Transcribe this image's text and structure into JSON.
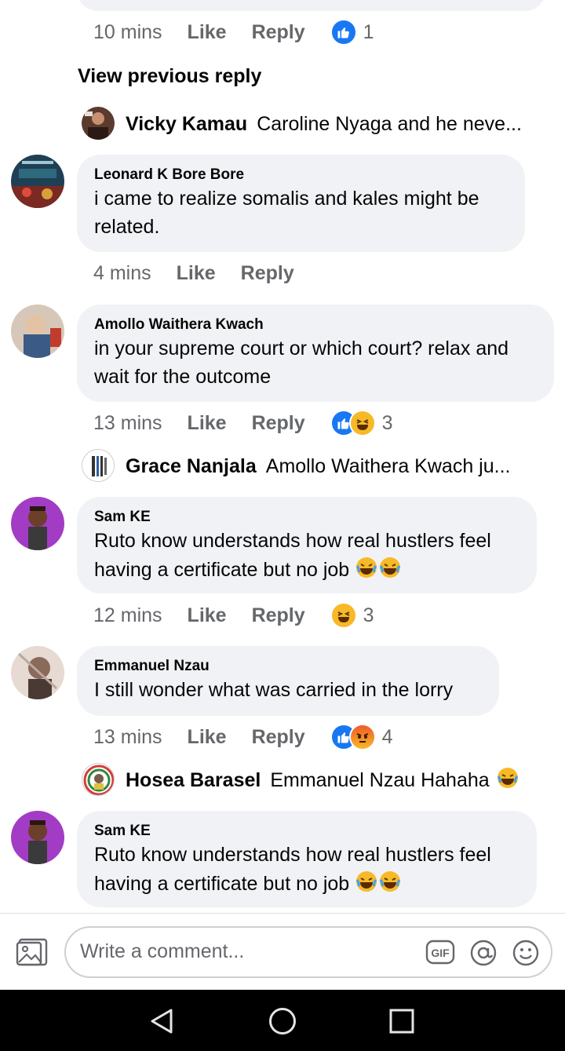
{
  "top_comment": {
    "time": "10 mins",
    "like": "Like",
    "reply": "Reply",
    "reactions": [
      "like-icon"
    ],
    "count": "1"
  },
  "view_previous": "View previous reply",
  "replies": [
    {
      "name": "Vicky Kamau",
      "text": "Caroline Nyaga and he neve..."
    },
    {
      "name": "Grace Nanjala",
      "text": "Amollo Waithera Kwach ju..."
    },
    {
      "name": "Hosea Barasel",
      "text": "Emmanuel Nzau Hahaha"
    }
  ],
  "comments": [
    {
      "name": "Leonard K Bore Bore",
      "line1": "i came to realize somalis and kales might be",
      "line2": "related.",
      "time": "4 mins",
      "like": "Like",
      "reply": "Reply",
      "count": ""
    },
    {
      "name": "Amollo Waithera Kwach",
      "line1": "in your supreme court or which court? relax and",
      "line2": "wait for the outcome",
      "time": "13 mins",
      "like": "Like",
      "reply": "Reply",
      "count": "3"
    },
    {
      "name": "Sam KE",
      "line1": "Ruto know understands how real hustlers feel",
      "line2": "having a certificate but no job",
      "time": "12 mins",
      "like": "Like",
      "reply": "Reply",
      "count": "3"
    },
    {
      "name": "Emmanuel Nzau",
      "line1": "I still wonder what was carried in the lorry",
      "line2": "",
      "time": "13 mins",
      "like": "Like",
      "reply": "Reply",
      "count": "4"
    },
    {
      "name": "Sam KE",
      "line1": "Ruto know understands how real hustlers feel",
      "line2": "having a certificate but no job"
    }
  ],
  "composer": {
    "placeholder": "Write a comment...",
    "gif_label": "GIF"
  },
  "colors": {
    "bubble": "#f0f2f5",
    "meta_text": "#65676b",
    "like_blue": "#1877f2",
    "haha_yellow": "#f7b928"
  }
}
